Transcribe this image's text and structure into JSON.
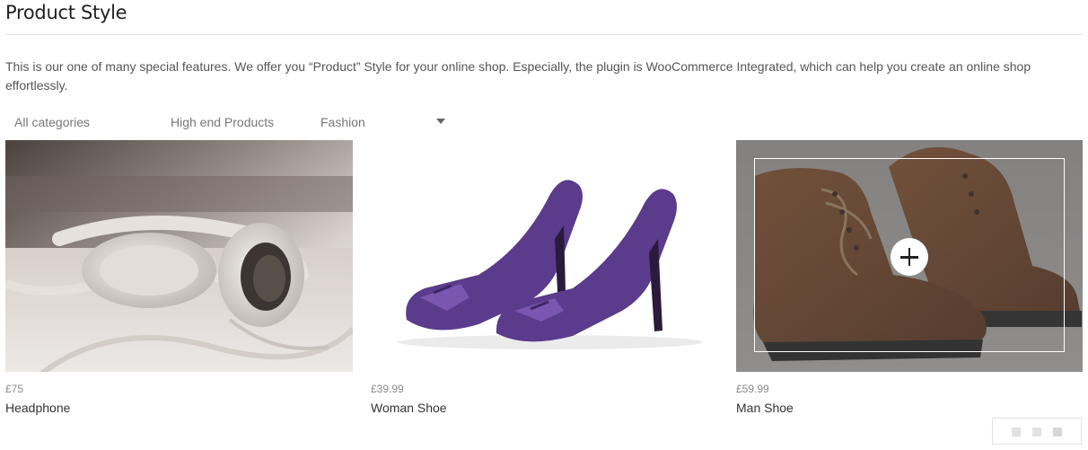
{
  "header": {
    "title": "Product Style",
    "description": "This is our one of many special features. We offer you “Product” Style for your online shop. Especially, the plugin is WooCommerce Integrated, which can help you create an online shop effortlessly."
  },
  "filters": {
    "items": [
      "All categories",
      "High end Products",
      "Fashion"
    ]
  },
  "products": [
    {
      "price": "£75",
      "name": "Headphone",
      "image_icon": "headphone-image"
    },
    {
      "price": "£39.99",
      "name": "Woman Shoe",
      "image_icon": "purple-heels-image"
    },
    {
      "price": "£59.99",
      "name": "Man Shoe",
      "image_icon": "brown-boots-image"
    }
  ],
  "colors": {
    "overlay": "#464646",
    "heels": "#5b3b8c",
    "boots": "#8a4a22"
  }
}
